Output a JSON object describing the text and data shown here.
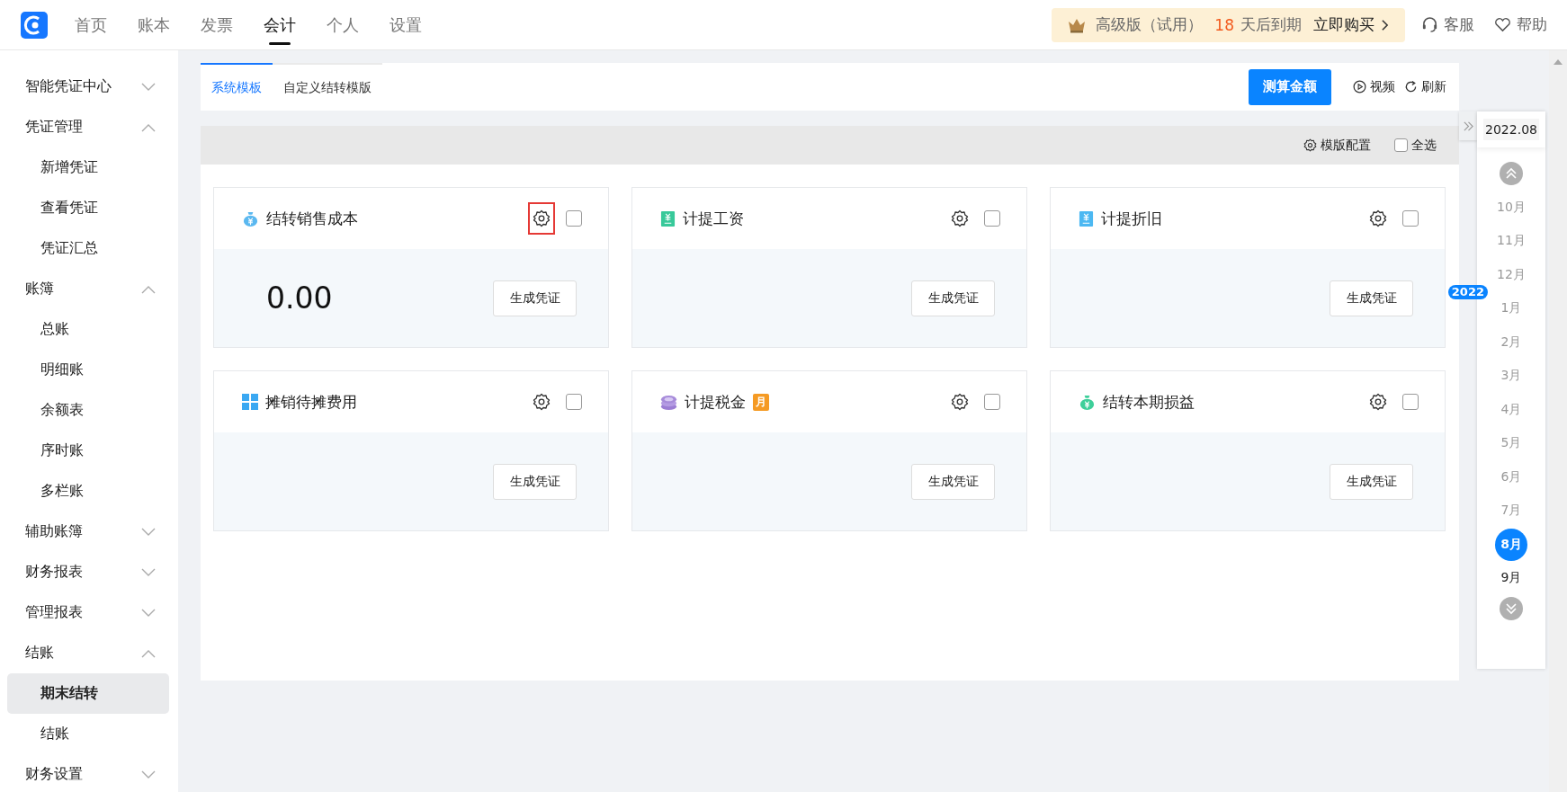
{
  "top_nav": {
    "tabs": [
      {
        "label": "首页",
        "selected": false
      },
      {
        "label": "账本",
        "selected": false
      },
      {
        "label": "发票",
        "selected": false
      },
      {
        "label": "会计",
        "selected": true
      },
      {
        "label": "个人",
        "selected": false
      },
      {
        "label": "设置",
        "selected": false
      }
    ],
    "promo": {
      "edition": "高级版（试用）",
      "days": "18",
      "days_text": "天后到期",
      "action": "立即购买"
    },
    "links": [
      {
        "kind": "service",
        "label": "客服"
      },
      {
        "kind": "help",
        "label": "帮助"
      }
    ]
  },
  "sidebar": {
    "items": [
      {
        "label": "智能凭证中心",
        "expanded": false
      },
      {
        "label": "凭证管理",
        "expanded": true,
        "children": [
          {
            "label": "新增凭证",
            "selected": false
          },
          {
            "label": "查看凭证",
            "selected": false
          },
          {
            "label": "凭证汇总",
            "selected": false
          }
        ]
      },
      {
        "label": "账簿",
        "expanded": true,
        "children": [
          {
            "label": "总账",
            "selected": false
          },
          {
            "label": "明细账",
            "selected": false
          },
          {
            "label": "余额表",
            "selected": false
          },
          {
            "label": "序时账",
            "selected": false
          },
          {
            "label": "多栏账",
            "selected": false
          }
        ]
      },
      {
        "label": "辅助账簿",
        "expanded": false
      },
      {
        "label": "财务报表",
        "expanded": false
      },
      {
        "label": "管理报表",
        "expanded": false
      },
      {
        "label": "结账",
        "expanded": true,
        "children": [
          {
            "label": "期末结转",
            "selected": true
          },
          {
            "label": "结账",
            "selected": false
          }
        ]
      },
      {
        "label": "财务设置",
        "expanded": false
      }
    ]
  },
  "tabs": [
    {
      "label": "系统模板",
      "selected": true
    },
    {
      "label": "自定义结转模版",
      "selected": false
    }
  ],
  "actions": {
    "primary": "测算金额",
    "video": "视频",
    "refresh": "刷新"
  },
  "toolbar": {
    "config": "模版配置",
    "select_all": {
      "label": "全选",
      "checked": false
    }
  },
  "cards": [
    {
      "title": "结转销售成本",
      "amount": "0.00",
      "highlighted": true,
      "checked": false,
      "button": "生成凭证"
    },
    {
      "title": "计提工资",
      "highlighted": false,
      "checked": false,
      "button": "生成凭证"
    },
    {
      "title": "计提折旧",
      "highlighted": false,
      "checked": false,
      "button": "生成凭证"
    },
    {
      "title": "摊销待摊费用",
      "highlighted": false,
      "checked": false,
      "button": "生成凭证"
    },
    {
      "title": "计提税金",
      "badge": "月",
      "highlighted": false,
      "checked": false,
      "button": "生成凭证"
    },
    {
      "title": "结转本期损益",
      "highlighted": false,
      "checked": false,
      "button": "生成凭证"
    }
  ],
  "calendar": {
    "current": "2022.08",
    "months": [
      {
        "label": "10月",
        "dimmed": true,
        "selected": false
      },
      {
        "label": "11月",
        "dimmed": true,
        "selected": false
      },
      {
        "label": "12月",
        "dimmed": true,
        "selected": false
      },
      {
        "label": "1月",
        "year": "2022",
        "dimmed": true,
        "selected": false
      },
      {
        "label": "2月",
        "dimmed": true,
        "selected": false
      },
      {
        "label": "3月",
        "dimmed": true,
        "selected": false
      },
      {
        "label": "4月",
        "dimmed": true,
        "selected": false
      },
      {
        "label": "5月",
        "dimmed": true,
        "selected": false
      },
      {
        "label": "6月",
        "dimmed": true,
        "selected": false
      },
      {
        "label": "7月",
        "dimmed": true,
        "selected": false
      },
      {
        "label": "8月",
        "dimmed": false,
        "selected": true
      },
      {
        "label": "9月",
        "dimmed": false,
        "selected": false
      }
    ]
  }
}
